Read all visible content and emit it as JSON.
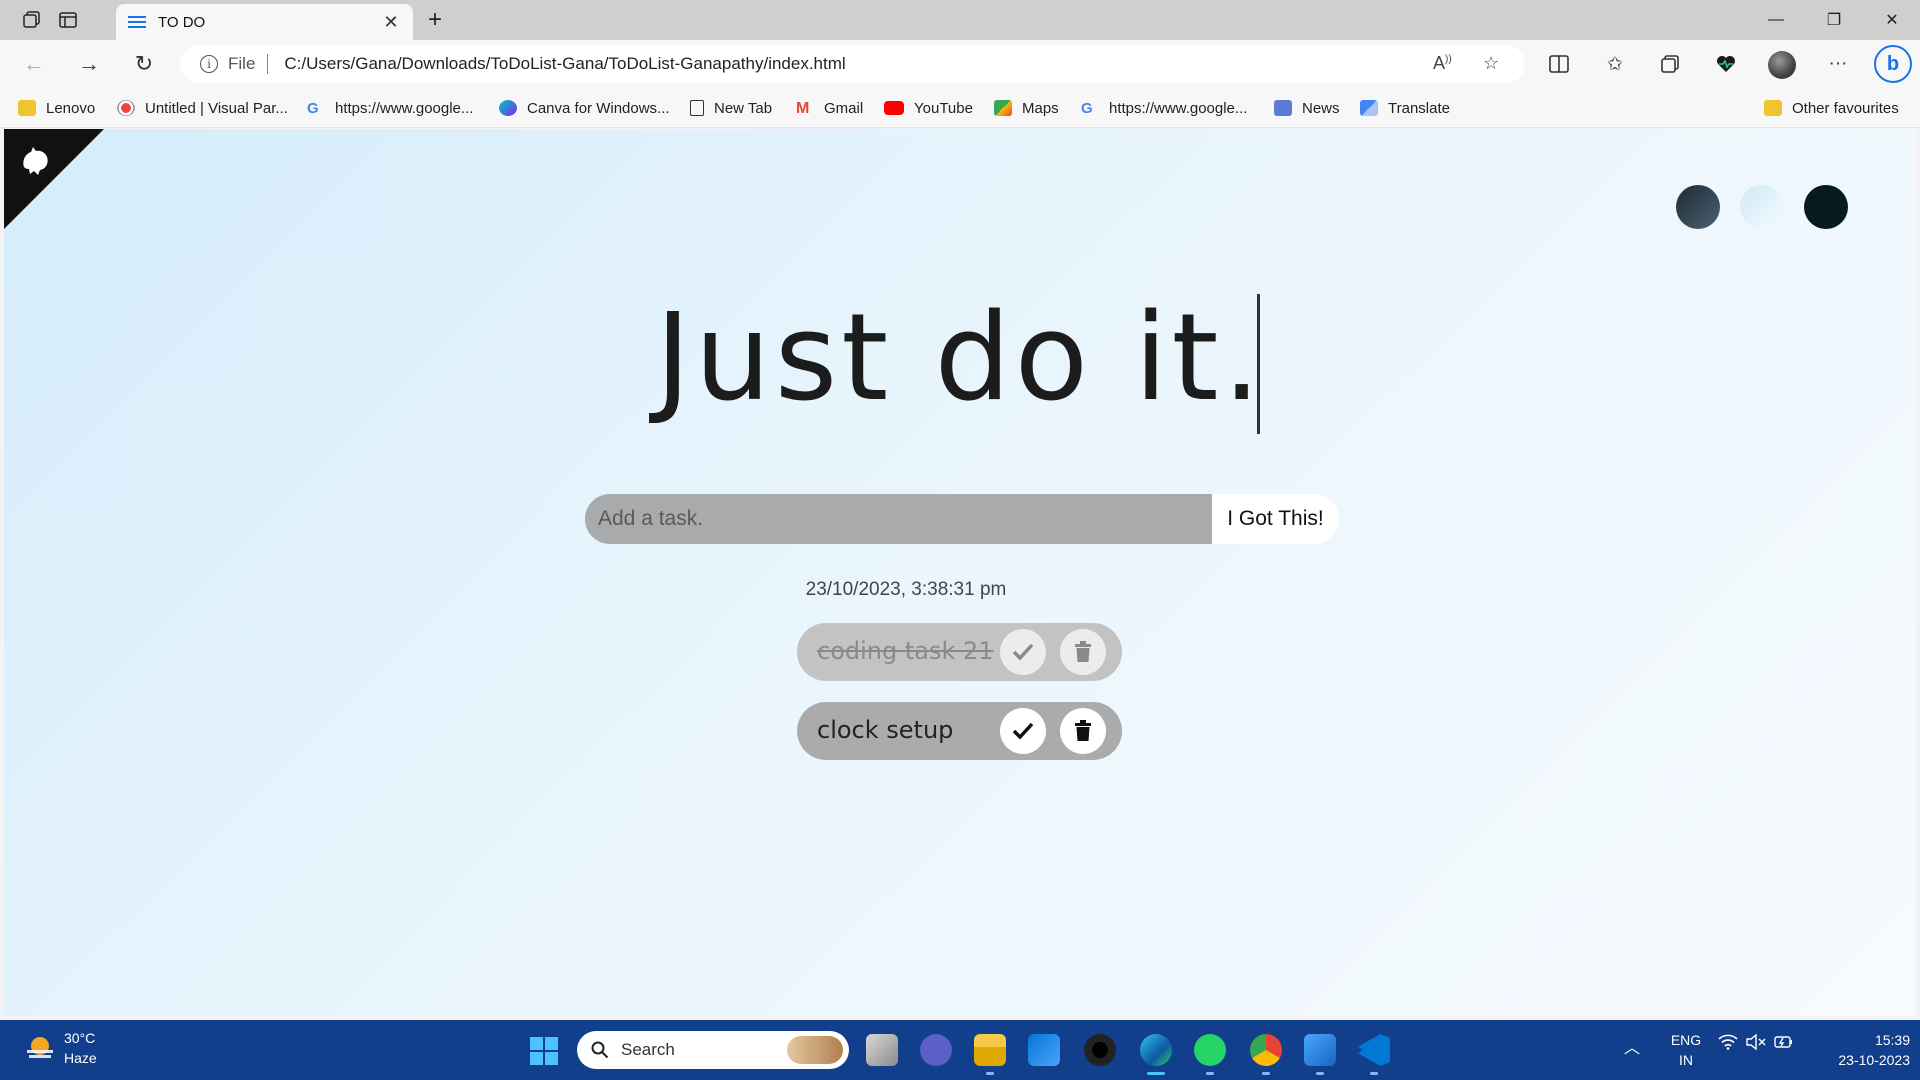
{
  "browser": {
    "tab_title": "TO DO",
    "scheme_label": "File",
    "url": "C:/Users/Gana/Downloads/ToDoList-Gana/ToDoList-Ganapathy/index.html"
  },
  "bookmarks": [
    {
      "label": "Lenovo",
      "icon": "folder-icon"
    },
    {
      "label": "Untitled | Visual Par...",
      "icon": "visual-paradigm-icon"
    },
    {
      "label": "https://www.google...",
      "icon": "google-icon"
    },
    {
      "label": "Canva for Windows...",
      "icon": "canva-icon"
    },
    {
      "label": "New Tab",
      "icon": "page-icon"
    },
    {
      "label": "Gmail",
      "icon": "gmail-icon"
    },
    {
      "label": "YouTube",
      "icon": "youtube-icon"
    },
    {
      "label": "Maps",
      "icon": "maps-icon"
    },
    {
      "label": "https://www.google...",
      "icon": "google-icon"
    },
    {
      "label": "News",
      "icon": "news-icon"
    },
    {
      "label": "Translate",
      "icon": "translate-icon"
    }
  ],
  "other_favourites": "Other favourites",
  "app": {
    "heading": "Just do it.",
    "input_placeholder": "Add a task.",
    "submit_label": "I Got This!",
    "datetime": "23/10/2023, 3:38:31 pm",
    "todos": [
      {
        "text": "coding task 21",
        "completed": true
      },
      {
        "text": "clock setup",
        "completed": false
      }
    ],
    "theme_colors": [
      "#2d3e4a",
      "#e3f3fb",
      "#061a1f"
    ]
  },
  "taskbar": {
    "weather_temp": "30°C",
    "weather_desc": "Haze",
    "search_label": "Search",
    "lang_top": "ENG",
    "lang_bottom": "IN",
    "time": "15:39",
    "date": "23-10-2023"
  }
}
